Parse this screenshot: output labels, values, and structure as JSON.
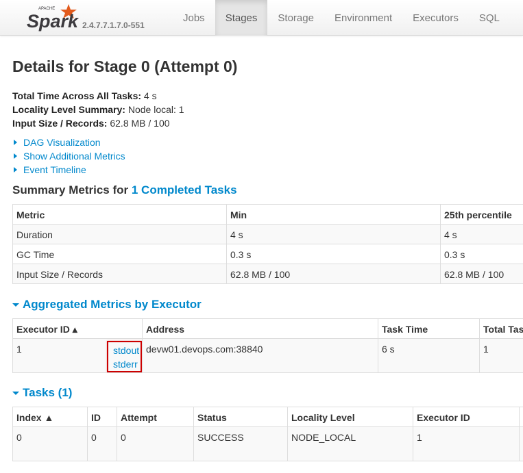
{
  "navbar": {
    "brand_top": "APACHE",
    "brand_name": "Spark",
    "version": "2.4.7.7.1.7.0-551",
    "tabs": [
      {
        "label": "Jobs",
        "active": false
      },
      {
        "label": "Stages",
        "active": true
      },
      {
        "label": "Storage",
        "active": false
      },
      {
        "label": "Environment",
        "active": false
      },
      {
        "label": "Executors",
        "active": false
      },
      {
        "label": "SQL",
        "active": false
      }
    ]
  },
  "page": {
    "title": "Details for Stage 0 (Attempt 0)",
    "summary": [
      {
        "key": "Total Time Across All Tasks:",
        "value": "4 s"
      },
      {
        "key": "Locality Level Summary:",
        "value": "Node local: 1"
      },
      {
        "key": "Input Size / Records:",
        "value": "62.8 MB / 100"
      }
    ],
    "expanders": [
      "DAG Visualization",
      "Show Additional Metrics",
      "Event Timeline"
    ]
  },
  "summary_metrics": {
    "heading_prefix": "Summary Metrics for",
    "heading_link": "1 Completed Tasks",
    "columns": [
      "Metric",
      "Min",
      "25th percentile"
    ],
    "rows": [
      [
        "Duration",
        "4 s",
        "4 s"
      ],
      [
        "GC Time",
        "0.3 s",
        "0.3 s"
      ],
      [
        "Input Size / Records",
        "62.8 MB / 100",
        "62.8 MB / 100"
      ]
    ]
  },
  "aggregated": {
    "heading": "Aggregated Metrics by Executor",
    "columns": [
      "Executor ID ▴",
      "Address",
      "Task Time",
      "Total Tas"
    ],
    "row": {
      "executor_id": "1",
      "stdout": "stdout",
      "stderr": "stderr",
      "address": "devw01.devops.com:38840",
      "task_time": "6 s",
      "total_tasks": "1"
    }
  },
  "tasks": {
    "heading": "Tasks (1)",
    "columns": [
      "Index ▲",
      "ID",
      "Attempt",
      "Status",
      "Locality Level",
      "Executor ID",
      ""
    ],
    "row": [
      "0",
      "0",
      "0",
      "SUCCESS",
      "NODE_LOCAL",
      "1",
      ""
    ]
  },
  "colors": {
    "link": "#0088cc",
    "highlight": "#cc0000",
    "brand_orange": "#e25a1c",
    "brand_text": "#3c3a3e"
  }
}
